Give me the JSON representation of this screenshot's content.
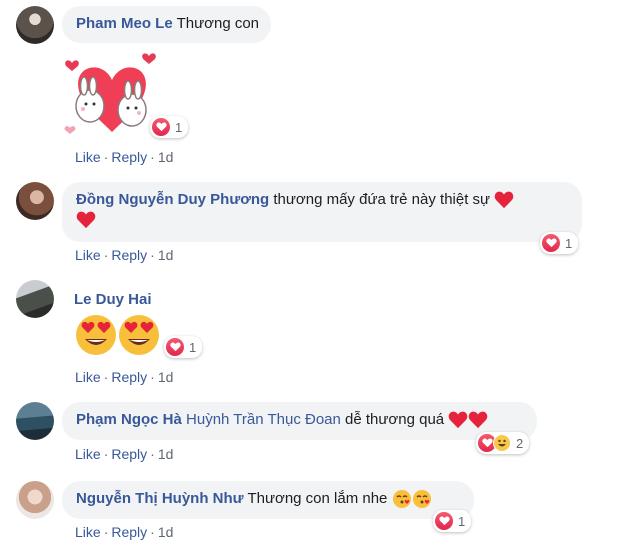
{
  "actions": {
    "like": "Like",
    "reply": "Reply",
    "dot": "·"
  },
  "comments": [
    {
      "author": "Pham Meo Le",
      "text": "Thương con",
      "reactions": "1",
      "time": "1d"
    },
    {
      "author": "Đồng Nguyễn Duy Phương",
      "text": "thương mấy đứa trẻ này thiệt sự",
      "reactions": "1",
      "time": "1d"
    },
    {
      "author": "Le Duy Hai",
      "text": "",
      "reactions": "1",
      "time": "1d"
    },
    {
      "author": "Phạm Ngọc Hà",
      "mention": "Huỳnh Trần Thục Đoan",
      "text": "dễ thương quá",
      "reactions": "2",
      "time": "1d"
    },
    {
      "author": "Nguyễn Thị Huỳnh Như",
      "text": "Thương con lắm nhe",
      "reactions": "1",
      "time": "1d"
    }
  ],
  "icons": {
    "heart": "heart-icon",
    "heart_eyes": "heart-eyes-emoji",
    "kiss": "kissing-heart-emoji",
    "haha": "haha-reaction-icon",
    "sticker": "bunnies-heart-sticker"
  },
  "colors": {
    "author": "#385898",
    "bubble": "#f2f3f5",
    "love": "#f33e58",
    "meta": "#606770"
  }
}
